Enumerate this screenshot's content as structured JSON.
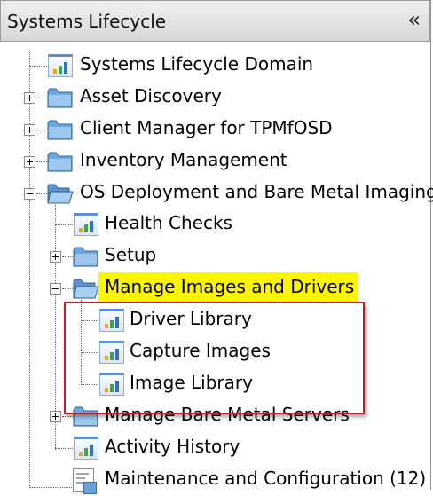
{
  "header": {
    "title": "Systems Lifecycle",
    "collapse_label": "«"
  },
  "tree": {
    "items": [
      {
        "label": "Systems Lifecycle Domain",
        "icon": "chart-icon"
      },
      {
        "label": "Asset Discovery",
        "icon": "folder-icon",
        "expander": "plus"
      },
      {
        "label": "Client Manager for TPMfOSD",
        "icon": "folder-icon",
        "expander": "plus"
      },
      {
        "label": "Inventory Management",
        "icon": "folder-icon",
        "expander": "plus"
      },
      {
        "label": "OS Deployment and Bare Metal Imaging",
        "icon": "folder-open-icon",
        "expander": "minus"
      },
      {
        "label": "Health Checks",
        "icon": "chart-icon"
      },
      {
        "label": "Setup",
        "icon": "folder-icon",
        "expander": "plus"
      },
      {
        "label": "Manage Images and Drivers",
        "icon": "folder-open-icon",
        "expander": "minus",
        "highlighted": true
      },
      {
        "label": "Driver Library",
        "icon": "chart-icon"
      },
      {
        "label": "Capture Images",
        "icon": "chart-icon"
      },
      {
        "label": "Image Library",
        "icon": "chart-icon"
      },
      {
        "label": "Manage Bare Metal Servers",
        "icon": "folder-icon",
        "expander": "plus"
      },
      {
        "label": "Activity History",
        "icon": "chart-icon"
      },
      {
        "label": "Maintenance and Configuration (12)",
        "icon": "maintenance-icon"
      }
    ]
  },
  "colors": {
    "highlight": "#fbf600",
    "callout_border": "#b8232a",
    "folder": "#6ea6df",
    "chart_bars": [
      "#f2a11a",
      "#3aa83a",
      "#2f6fd0"
    ]
  }
}
